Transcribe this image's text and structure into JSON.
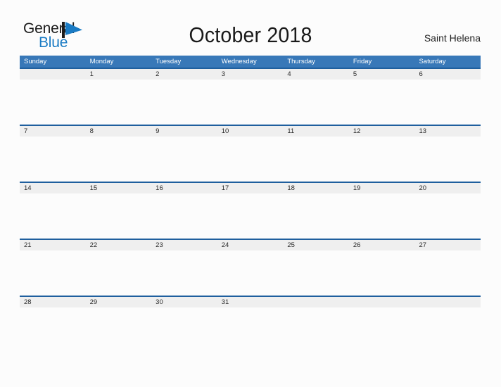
{
  "logo": {
    "word_one": "General",
    "word_two": "Blue",
    "flag_icon": "blue-flag-triangle-icon",
    "accent_color": "#1a7bc4"
  },
  "header": {
    "title": "October 2018",
    "month": "October",
    "year": "2018",
    "location": "Saint Helena"
  },
  "theme": {
    "header_blue": "#3878b8",
    "row_rule_blue": "#1f5f9e",
    "date_band_gray": "#efefef",
    "page_background": "#fcfcfc"
  },
  "calendar": {
    "day_headers": [
      "Sunday",
      "Monday",
      "Tuesday",
      "Wednesday",
      "Thursday",
      "Friday",
      "Saturday"
    ],
    "weeks": [
      {
        "days": [
          "",
          "1",
          "2",
          "3",
          "4",
          "5",
          "6"
        ]
      },
      {
        "days": [
          "7",
          "8",
          "9",
          "10",
          "11",
          "12",
          "13"
        ]
      },
      {
        "days": [
          "14",
          "15",
          "16",
          "17",
          "18",
          "19",
          "20"
        ]
      },
      {
        "days": [
          "21",
          "22",
          "23",
          "24",
          "25",
          "26",
          "27"
        ]
      },
      {
        "days": [
          "28",
          "29",
          "30",
          "31",
          "",
          "",
          ""
        ]
      }
    ]
  }
}
